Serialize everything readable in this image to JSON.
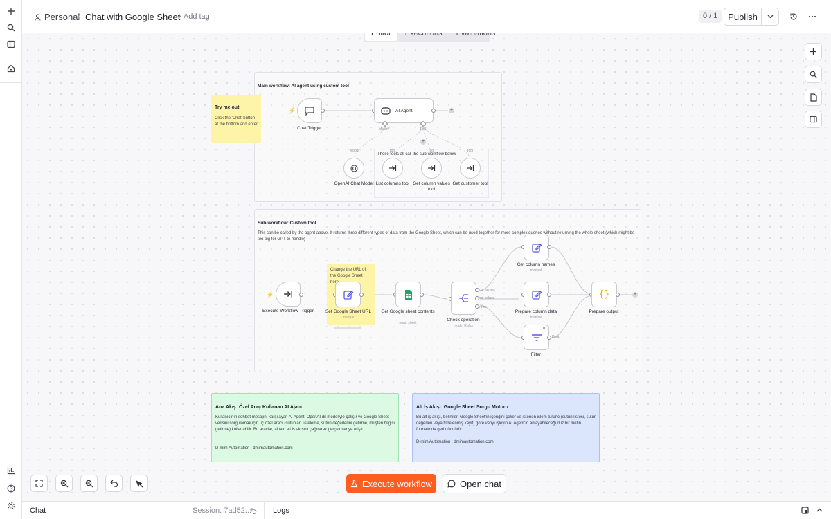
{
  "header": {
    "workspace": "Personal",
    "separator": "/",
    "workflow_name": "Chat with Google Sheet",
    "add_tag": "+ Add tag",
    "version_counter": "0 / 1",
    "publish_label": "Publish"
  },
  "tabs": [
    {
      "label": "Editor",
      "active": true
    },
    {
      "label": "Executions",
      "active": false
    },
    {
      "label": "Evaluations",
      "active": false
    }
  ],
  "main_frame": {
    "title": "Main workflow: AI agent using custom tool",
    "tools_note": "These tools all call the sub-workflow below"
  },
  "sticky_try": {
    "title": "Try me out",
    "text": "Click the 'Chat' button at the bottom and enter:"
  },
  "main_nodes": {
    "chat_trigger": "Chat Trigger",
    "ai_agent": "AI Agent",
    "model_handle": "Model*",
    "tool_handle": "Tool",
    "openai": "OpenAI Chat Model",
    "model_port": "Model",
    "list_columns": "List columns tool",
    "get_values": "Get column values tool",
    "get_customer": "Get customer tool",
    "tool_port": "Tool"
  },
  "sub_frame": {
    "title": "Sub-workflow: Custom tool",
    "desc": "This can be called by the agent above. It returns three different types of data from the Google Sheet, which can be used together for more complex queries without returning the whole sheet (which might be too big for GPT to handle)"
  },
  "sticky_url": {
    "text": "Change the URL of the Google Sheet here"
  },
  "sub_nodes": {
    "execute_trigger": "Execute Workflow Trigger",
    "set_url": "Set Google Sheet URL",
    "set_url_sub": "manual",
    "get_sheet": "Get Google sheet contents",
    "get_sheet_sub": "read: sheet",
    "check_op": "Check operation",
    "check_op_sub": "mode: Rules",
    "out_col_names": "col names",
    "out_col_values": "col values",
    "out_rows": "rows",
    "get_col_names": "Get column names",
    "get_col_names_sub": "manual",
    "get_col_names_badge": "1",
    "prepare_col": "Prepare column data",
    "prepare_col_sub": "manual",
    "filter": "Filter",
    "filter_badge": "0",
    "filter_kept": "Kept",
    "prepare_output": "Prepare output"
  },
  "note_green": {
    "title": "Ana Akış: Özel Araç Kullanan AI Ajanı",
    "text": "Kullanıcının sohbet mesajını karşılayan AI Agent, OpenAI dil modeliyle çalışır ve Google Sheet verisini sorgulamak için üç özel aracı (sütunları listeleme, sütun değerlerini getirme, müşteri bilgisi getirme) kullanabilir. Bu araçlar, alttaki alt iş akışını çağırarak gerçek veriye erişir.",
    "sig_prefix": "D-mim Automation |",
    "sig_link": "dmimautomation.com"
  },
  "note_blue": {
    "title": "Alt İş Akışı: Google Sheet Sorgu Motoru",
    "text": "Bu alt iş akışı, belirtilen Google Sheet'in içeriğini çeker ve istenen işlem türüne (sütun listesi, sütun değerleri veya filtrelenmiş kayıt) göre veriyi işleyip AI Agent'ın anlayabileceği düz bir metin formatında geri döndürür.",
    "sig_prefix": "D-mim Automation |",
    "sig_link": "dmimautomation.com"
  },
  "actions": {
    "execute": "Execute workflow",
    "open_chat": "Open chat"
  },
  "bottom": {
    "chat": "Chat",
    "session": "Session: 7ad52...",
    "logs": "Logs"
  },
  "colors": {
    "accent": "#ff5c1f",
    "sticky_yellow": "#fdf4a8",
    "note_green": "#dcf9e4",
    "note_blue": "#dbe6fd",
    "node_icon": "#5a5ae0",
    "sheets_green": "#20a464",
    "output_orange": "#f0a020"
  },
  "icons": [
    "plus-icon",
    "search-icon",
    "panel-icon",
    "home-icon",
    "chart-icon",
    "help-icon",
    "settings-icon",
    "user-icon",
    "history-icon",
    "more-icon",
    "chat-icon",
    "robot-icon",
    "openai-icon",
    "tool-arrow-icon",
    "edit-icon",
    "sheets-icon",
    "switch-icon",
    "filter-icon",
    "braces-icon",
    "bolt-icon",
    "flask-icon",
    "fullscreen-icon",
    "zoom-in-icon",
    "zoom-out-icon",
    "undo-icon",
    "cursor-icon",
    "page-icon",
    "sidebar-icon",
    "undo-session-icon",
    "popout-icon",
    "chevron-up-icon"
  ]
}
